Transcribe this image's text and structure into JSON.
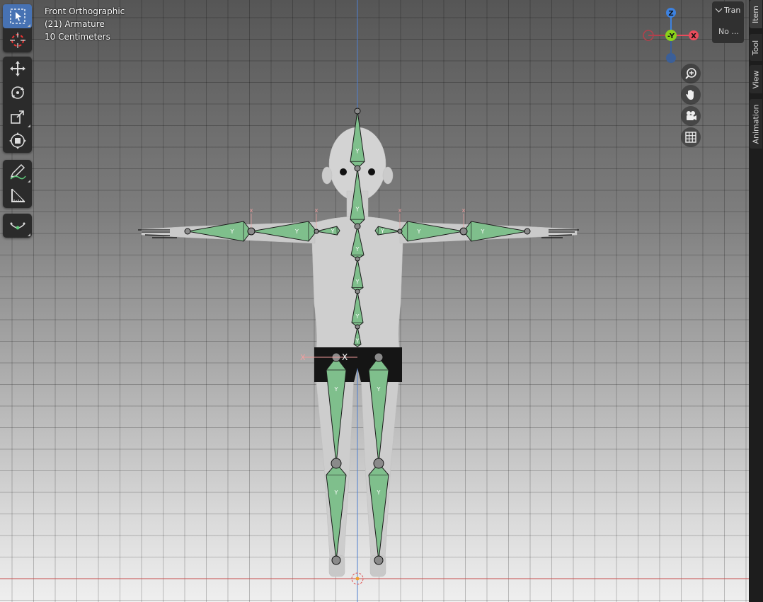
{
  "viewport": {
    "view_name": "Front Orthographic",
    "object_info": "(21) Armature",
    "scale_info": "10 Centimeters"
  },
  "toolbar": {
    "tools": [
      {
        "name": "select-box",
        "icon": "select-box-icon",
        "active": true
      },
      {
        "name": "cursor",
        "icon": "cursor-icon",
        "active": false
      },
      {
        "name": "move",
        "icon": "move-icon",
        "active": false
      },
      {
        "name": "rotate",
        "icon": "rotate-icon",
        "active": false
      },
      {
        "name": "scale",
        "icon": "scale-icon",
        "active": false
      },
      {
        "name": "transform",
        "icon": "transform-icon",
        "active": false
      },
      {
        "name": "annotate",
        "icon": "annotate-icon",
        "active": false
      },
      {
        "name": "measure",
        "icon": "measure-icon",
        "active": false
      },
      {
        "name": "roll",
        "icon": "bone-roll-icon",
        "active": false
      }
    ]
  },
  "gizmo": {
    "axes": {
      "z": "Z",
      "y": "-Y",
      "x": "X"
    },
    "colors": {
      "x": "#e94c5c",
      "y": "#8ad11b",
      "z": "#3d82e0",
      "x_neg": "#b2404c",
      "z_neg": "#3b5f98"
    }
  },
  "nav_buttons": [
    "zoom-icon",
    "pan-hand-icon",
    "camera-icon",
    "ortho-grid-icon"
  ],
  "panel": {
    "header": "Tran",
    "value": "No ..."
  },
  "sidebar_tabs": [
    {
      "label": "Item",
      "active": true
    },
    {
      "label": "Tool",
      "active": false
    },
    {
      "label": "View",
      "active": false
    },
    {
      "label": "Animation",
      "active": false
    }
  ],
  "colors": {
    "bone_fill": "#7fbf8c",
    "bone_outline": "#1b1b1b",
    "mesh": "#cfd0d0",
    "shorts": "#151515",
    "active_tool": "#4772b3",
    "x_axis_line": "#c84a4a",
    "z_axis_line": "#4f7fcf"
  },
  "bone_labels": {
    "x": "X",
    "y": "Y"
  }
}
